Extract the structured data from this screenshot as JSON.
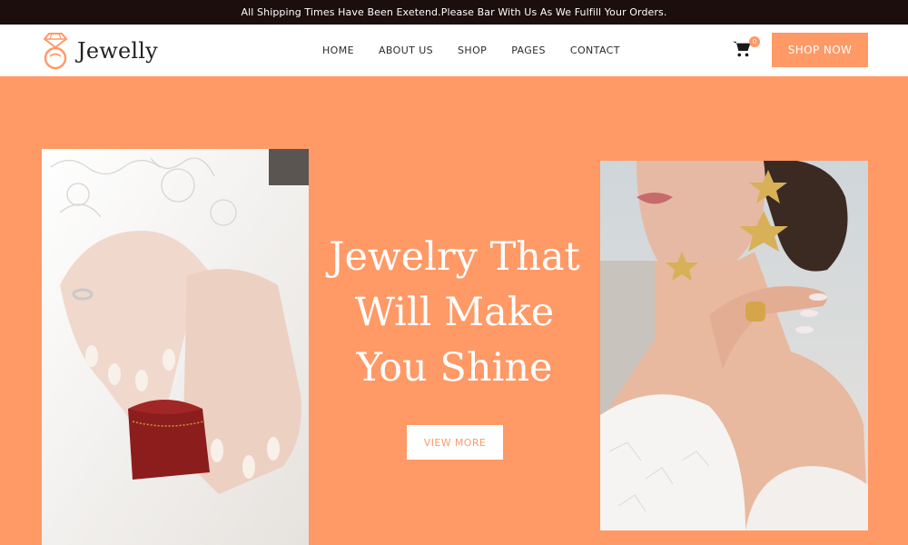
{
  "announcement": "All Shipping Times Have Been Exetend.Please Bar With Us As We Fulfill Your Orders.",
  "brand": {
    "name": "Jewelly",
    "icon": "diamond-ring-icon"
  },
  "nav": {
    "items": [
      {
        "label": "HOME"
      },
      {
        "label": "ABOUT US"
      },
      {
        "label": "SHOP"
      },
      {
        "label": "PAGES"
      },
      {
        "label": "CONTACT"
      }
    ]
  },
  "cart": {
    "icon": "shopping-cart-icon",
    "count": "0"
  },
  "header_button": "SHOP NOW",
  "hero": {
    "headline": [
      "Jewelry That",
      "Will Make",
      "You Shine"
    ],
    "cta": "VIEW MORE"
  },
  "colors": {
    "accent": "#ff9966",
    "topbar": "#1b0e0c",
    "white": "#ffffff"
  }
}
